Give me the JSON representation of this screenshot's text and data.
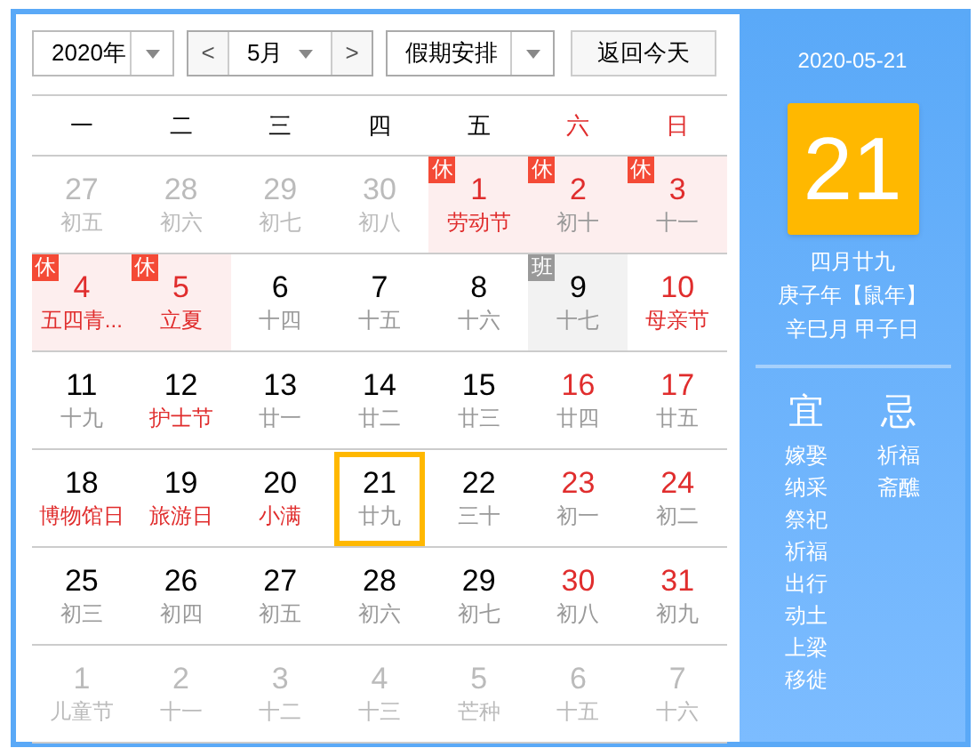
{
  "toolbar": {
    "year": "2020年",
    "month": "5月",
    "prev": "<",
    "next": ">",
    "holiday": "假期安排",
    "today_button": "返回今天"
  },
  "weekdays": [
    {
      "label": "一",
      "weekend": false
    },
    {
      "label": "二",
      "weekend": false
    },
    {
      "label": "三",
      "weekend": false
    },
    {
      "label": "四",
      "weekend": false
    },
    {
      "label": "五",
      "weekend": false
    },
    {
      "label": "六",
      "weekend": true
    },
    {
      "label": "日",
      "weekend": true
    }
  ],
  "weeks": [
    [
      {
        "day": "27",
        "lunar": "初五",
        "kind": "other"
      },
      {
        "day": "28",
        "lunar": "初六",
        "kind": "other"
      },
      {
        "day": "29",
        "lunar": "初七",
        "kind": "other"
      },
      {
        "day": "30",
        "lunar": "初八",
        "kind": "other"
      },
      {
        "day": "1",
        "lunar": "劳动节",
        "kind": "current",
        "red": true,
        "festival": true,
        "tag": "休",
        "workday": false,
        "selected": false
      },
      {
        "day": "2",
        "lunar": "初十",
        "kind": "current",
        "red": true,
        "festival": false,
        "tag": "休",
        "workday": false,
        "selected": false
      },
      {
        "day": "3",
        "lunar": "十一",
        "kind": "current",
        "red": true,
        "festival": false,
        "tag": "休",
        "workday": false,
        "selected": false
      }
    ],
    [
      {
        "day": "4",
        "lunar": "五四青...",
        "kind": "current",
        "red": true,
        "festival": true,
        "tag": "休",
        "workday": false,
        "selected": false
      },
      {
        "day": "5",
        "lunar": "立夏",
        "kind": "current",
        "red": true,
        "festival": true,
        "tag": "休",
        "workday": false,
        "selected": false
      },
      {
        "day": "6",
        "lunar": "十四",
        "kind": "current",
        "red": false,
        "festival": false,
        "selected": false
      },
      {
        "day": "7",
        "lunar": "十五",
        "kind": "current",
        "red": false,
        "festival": false,
        "selected": false
      },
      {
        "day": "8",
        "lunar": "十六",
        "kind": "current",
        "red": false,
        "festival": false,
        "selected": false
      },
      {
        "day": "9",
        "lunar": "十七",
        "kind": "current",
        "red": false,
        "festival": false,
        "tag": "班",
        "workday": true,
        "selected": false
      },
      {
        "day": "10",
        "lunar": "母亲节",
        "kind": "current",
        "red": true,
        "festival": true,
        "selected": false
      }
    ],
    [
      {
        "day": "11",
        "lunar": "十九",
        "kind": "current",
        "red": false,
        "festival": false,
        "selected": false
      },
      {
        "day": "12",
        "lunar": "护士节",
        "kind": "current",
        "red": false,
        "festival": true,
        "selected": false
      },
      {
        "day": "13",
        "lunar": "廿一",
        "kind": "current",
        "red": false,
        "festival": false,
        "selected": false
      },
      {
        "day": "14",
        "lunar": "廿二",
        "kind": "current",
        "red": false,
        "festival": false,
        "selected": false
      },
      {
        "day": "15",
        "lunar": "廿三",
        "kind": "current",
        "red": false,
        "festival": false,
        "selected": false
      },
      {
        "day": "16",
        "lunar": "廿四",
        "kind": "current",
        "red": true,
        "festival": false,
        "selected": false
      },
      {
        "day": "17",
        "lunar": "廿五",
        "kind": "current",
        "red": true,
        "festival": false,
        "selected": false
      }
    ],
    [
      {
        "day": "18",
        "lunar": "博物馆日",
        "kind": "current",
        "red": false,
        "festival": true,
        "selected": false
      },
      {
        "day": "19",
        "lunar": "旅游日",
        "kind": "current",
        "red": false,
        "festival": true,
        "selected": false
      },
      {
        "day": "20",
        "lunar": "小满",
        "kind": "current",
        "red": false,
        "festival": true,
        "selected": false
      },
      {
        "day": "21",
        "lunar": "廿九",
        "kind": "current",
        "red": false,
        "festival": false,
        "selected": true
      },
      {
        "day": "22",
        "lunar": "三十",
        "kind": "current",
        "red": false,
        "festival": false,
        "selected": false
      },
      {
        "day": "23",
        "lunar": "初一",
        "kind": "current",
        "red": true,
        "festival": false,
        "selected": false
      },
      {
        "day": "24",
        "lunar": "初二",
        "kind": "current",
        "red": true,
        "festival": false,
        "selected": false
      }
    ],
    [
      {
        "day": "25",
        "lunar": "初三",
        "kind": "current",
        "red": false,
        "festival": false,
        "selected": false
      },
      {
        "day": "26",
        "lunar": "初四",
        "kind": "current",
        "red": false,
        "festival": false,
        "selected": false
      },
      {
        "day": "27",
        "lunar": "初五",
        "kind": "current",
        "red": false,
        "festival": false,
        "selected": false
      },
      {
        "day": "28",
        "lunar": "初六",
        "kind": "current",
        "red": false,
        "festival": false,
        "selected": false
      },
      {
        "day": "29",
        "lunar": "初七",
        "kind": "current",
        "red": false,
        "festival": false,
        "selected": false
      },
      {
        "day": "30",
        "lunar": "初八",
        "kind": "current",
        "red": true,
        "festival": false,
        "selected": false
      },
      {
        "day": "31",
        "lunar": "初九",
        "kind": "current",
        "red": true,
        "festival": false,
        "selected": false
      }
    ],
    [
      {
        "day": "1",
        "lunar": "儿童节",
        "kind": "other"
      },
      {
        "day": "2",
        "lunar": "十一",
        "kind": "other"
      },
      {
        "day": "3",
        "lunar": "十二",
        "kind": "other"
      },
      {
        "day": "4",
        "lunar": "十三",
        "kind": "other"
      },
      {
        "day": "5",
        "lunar": "芒种",
        "kind": "other"
      },
      {
        "day": "6",
        "lunar": "十五",
        "kind": "other"
      },
      {
        "day": "7",
        "lunar": "十六",
        "kind": "other"
      }
    ]
  ],
  "detail": {
    "date": "2020-05-21",
    "day": "21",
    "lunar_date": "四月廿九",
    "year_line": "庚子年【鼠年】",
    "month_day_line": "辛巳月 甲子日",
    "good_label": "宜",
    "good": [
      "嫁娶",
      "纳采",
      "祭祀",
      "祈福",
      "出行",
      "动土",
      "上梁",
      "移徙"
    ],
    "bad_label": "忌",
    "bad": [
      "祈福",
      "斋醮"
    ]
  }
}
